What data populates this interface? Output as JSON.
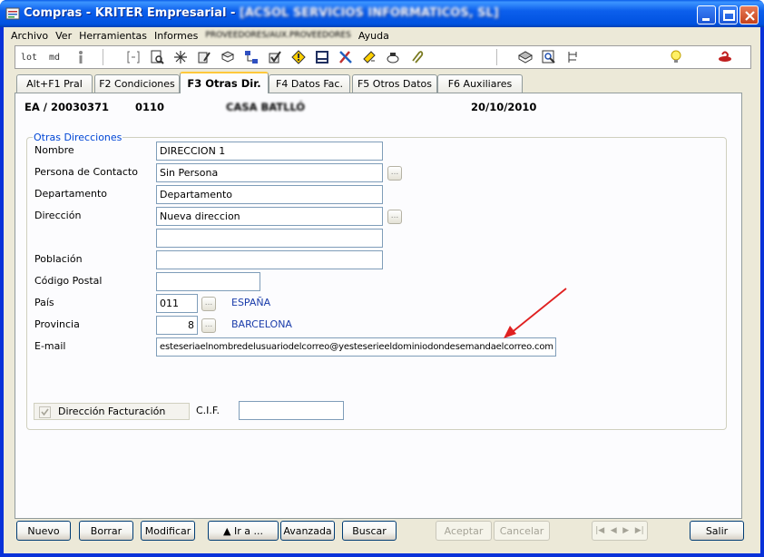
{
  "window": {
    "title": "Compras - KRITER Empresarial - ",
    "title_company": "[ACSOL SERVICIOS INFORMATICOS, SL]"
  },
  "menu": {
    "items": [
      "Archivo",
      "Ver",
      "Herramientas",
      "Informes",
      "PROVEEDORES/AUX.PROVEEDORES",
      "Ayuda"
    ]
  },
  "toolbar": {
    "lot_label": "lot",
    "md_label": "md",
    "icons": [
      "info-icon",
      "bracket-icon",
      "preview-icon",
      "star-icon",
      "edit-icon",
      "book-icon",
      "network-icon",
      "check-icon",
      "warning-icon",
      "grid-icon",
      "tools-icon",
      "phone-icon",
      "clip-icon",
      "disk-icon",
      "search-doc-icon",
      "tree-icon",
      "lightbulb-icon",
      "help-icon"
    ]
  },
  "tabs": [
    {
      "label": "Alt+F1 Pral"
    },
    {
      "label": "F2 Condiciones"
    },
    {
      "label": "F3 Otras Dir."
    },
    {
      "label": "F4 Datos Fac."
    },
    {
      "label": "F5 Otros Datos"
    },
    {
      "label": "F6 Auxiliares"
    }
  ],
  "header": {
    "doc_number": "EA / 20030371",
    "supplier_code": "0110",
    "supplier_name": "CASA BATLLÓ",
    "date": "20/10/2010"
  },
  "group": {
    "title": "Otras Direcciones"
  },
  "form": {
    "nombre_label": "Nombre",
    "nombre_value": "DIRECCION 1",
    "contacto_label": "Persona de Contacto",
    "contacto_value": "Sin Persona",
    "departamento_label": "Departamento",
    "departamento_value": "Departamento",
    "direccion_label": "Dirección",
    "direccion_value": "Nueva direccion",
    "direccion2_value": "",
    "poblacion_label": "Población",
    "poblacion_value": "",
    "cp_label": "Código Postal",
    "cp_value": "",
    "pais_label": "País",
    "pais_code": "011",
    "pais_name": "ESPAÑA",
    "provincia_label": "Provincia",
    "provincia_code": "8",
    "provincia_name": "BARCELONA",
    "email_label": "E-mail",
    "email_value": "esteseriaelnombredelusuariodelcorreo@yesteserieeldominiodondesemandaelcorreo.com",
    "facturacion_label": "Dirección Facturación",
    "cif_label": "C.I.F.",
    "cif_value": ""
  },
  "buttons": {
    "nuevo": "Nuevo",
    "borrar": "Borrar",
    "modificar": "Modificar",
    "ir_a": "▲ Ir a ...",
    "avanzada": "Avanzada",
    "buscar": "Buscar",
    "aceptar": "Aceptar",
    "cancelar": "Cancelar",
    "salir": "Salir"
  },
  "colors": {
    "titlebar": "#0052e0",
    "face": "#ece9d8",
    "accent_blue": "#1a3caa",
    "arrow": "#e02020"
  }
}
